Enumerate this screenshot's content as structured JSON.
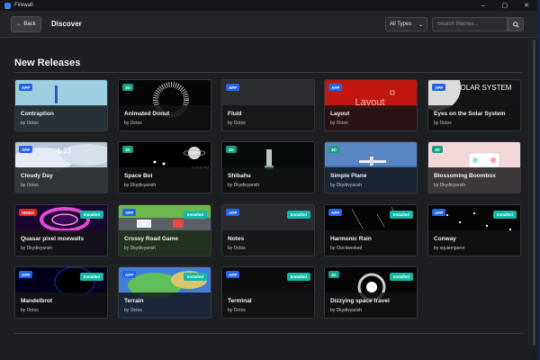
{
  "window": {
    "title": "Firewall",
    "controls": {
      "minimize": "–",
      "maximize": "▢",
      "close": "✕"
    }
  },
  "header": {
    "back_label": "Back",
    "back_icon": "arrow-left-icon",
    "title": "Discover",
    "type_select": {
      "value": "All Types"
    },
    "search": {
      "placeholder": "Search themes...",
      "icon": "search-icon"
    }
  },
  "section": {
    "title": "New Releases"
  },
  "cards": [
    {
      "title": "Contraption",
      "author": "by Octos",
      "type": "APP",
      "installed": false,
      "thumb": "contraption"
    },
    {
      "title": "Animated Donut",
      "author": "by Octos",
      "type": "3D",
      "installed": false,
      "thumb": "donut"
    },
    {
      "title": "Fluid",
      "author": "by Octos",
      "type": "APP",
      "installed": false,
      "thumb": "fluid"
    },
    {
      "title": "Layout",
      "author": "by Octos",
      "type": "APP",
      "installed": false,
      "thumb": "layout",
      "thumb_text": "Layout"
    },
    {
      "title": "Eyes on the Solar System",
      "author": "by Octos",
      "type": "APP",
      "installed": false,
      "thumb": "solar",
      "thumb_text": "OLAR SYSTEM"
    },
    {
      "title": "Cloudy Day",
      "author": "by Octos",
      "type": "APP",
      "installed": false,
      "thumb": "cloudy",
      "thumb_text": "1:13"
    },
    {
      "title": "Space Boi",
      "author": "by Dkydivyansh",
      "type": "3D",
      "installed": false,
      "thumb": "spaceboi",
      "thumb_text": "19:02:02 PM"
    },
    {
      "title": "Shibahu",
      "author": "by Dkydivyansh",
      "type": "3D",
      "installed": false,
      "thumb": "shibahu"
    },
    {
      "title": "Simple Plane",
      "author": "by Dkydivyansh",
      "type": "3D",
      "installed": false,
      "thumb": "plane"
    },
    {
      "title": "Blossoming Boombox",
      "author": "by Dkydivyansh",
      "type": "3D",
      "installed": false,
      "thumb": "boombox"
    },
    {
      "title": "Quasar pixel moewalls",
      "author": "by Dkydivyansh",
      "type": "VIDEO",
      "installed": true,
      "thumb": "quasar"
    },
    {
      "title": "Crossy Road Game",
      "author": "by Dkydivyansh",
      "type": "APP",
      "installed": true,
      "thumb": "crossy"
    },
    {
      "title": "Notes",
      "author": "by Octos",
      "type": "APP",
      "installed": true,
      "thumb": "notes"
    },
    {
      "title": "Harmonic Rain",
      "author": "by Clockworked",
      "type": "APP",
      "installed": true,
      "thumb": "rain"
    },
    {
      "title": "Conway",
      "author": "by squiemperor",
      "type": "APP",
      "installed": true,
      "thumb": "conway"
    },
    {
      "title": "Mandelbrot",
      "author": "by Octos",
      "type": "APP",
      "installed": true,
      "thumb": "mandelbrot"
    },
    {
      "title": "Terrain",
      "author": "by Octos",
      "type": "APP",
      "installed": true,
      "thumb": "terrain"
    },
    {
      "title": "Terminal",
      "author": "by Octos",
      "type": "APP",
      "installed": true,
      "thumb": "terminal"
    },
    {
      "title": "Dizzying space travel",
      "author": "by Dkydivyansh",
      "type": "3D",
      "installed": true,
      "thumb": "dizzy"
    }
  ],
  "installed_label": "Installed",
  "colors": {
    "app_badge": "#2563eb",
    "badge_3d": "#16a085",
    "video_badge": "#dc2626",
    "installed": "#14b8a6",
    "background": "#1e1f22"
  }
}
